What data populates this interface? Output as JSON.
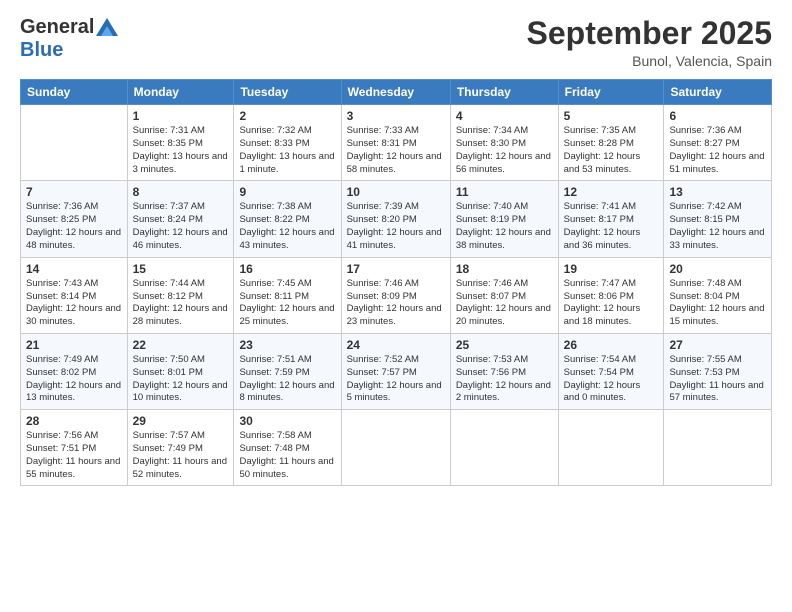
{
  "logo": {
    "general": "General",
    "blue": "Blue"
  },
  "title": "September 2025",
  "location": "Bunol, Valencia, Spain",
  "days_header": [
    "Sunday",
    "Monday",
    "Tuesday",
    "Wednesday",
    "Thursday",
    "Friday",
    "Saturday"
  ],
  "weeks": [
    [
      {
        "day": "",
        "info": ""
      },
      {
        "day": "1",
        "info": "Sunrise: 7:31 AM\nSunset: 8:35 PM\nDaylight: 13 hours\nand 3 minutes."
      },
      {
        "day": "2",
        "info": "Sunrise: 7:32 AM\nSunset: 8:33 PM\nDaylight: 13 hours\nand 1 minute."
      },
      {
        "day": "3",
        "info": "Sunrise: 7:33 AM\nSunset: 8:31 PM\nDaylight: 12 hours\nand 58 minutes."
      },
      {
        "day": "4",
        "info": "Sunrise: 7:34 AM\nSunset: 8:30 PM\nDaylight: 12 hours\nand 56 minutes."
      },
      {
        "day": "5",
        "info": "Sunrise: 7:35 AM\nSunset: 8:28 PM\nDaylight: 12 hours\nand 53 minutes."
      },
      {
        "day": "6",
        "info": "Sunrise: 7:36 AM\nSunset: 8:27 PM\nDaylight: 12 hours\nand 51 minutes."
      }
    ],
    [
      {
        "day": "7",
        "info": "Sunrise: 7:36 AM\nSunset: 8:25 PM\nDaylight: 12 hours\nand 48 minutes."
      },
      {
        "day": "8",
        "info": "Sunrise: 7:37 AM\nSunset: 8:24 PM\nDaylight: 12 hours\nand 46 minutes."
      },
      {
        "day": "9",
        "info": "Sunrise: 7:38 AM\nSunset: 8:22 PM\nDaylight: 12 hours\nand 43 minutes."
      },
      {
        "day": "10",
        "info": "Sunrise: 7:39 AM\nSunset: 8:20 PM\nDaylight: 12 hours\nand 41 minutes."
      },
      {
        "day": "11",
        "info": "Sunrise: 7:40 AM\nSunset: 8:19 PM\nDaylight: 12 hours\nand 38 minutes."
      },
      {
        "day": "12",
        "info": "Sunrise: 7:41 AM\nSunset: 8:17 PM\nDaylight: 12 hours\nand 36 minutes."
      },
      {
        "day": "13",
        "info": "Sunrise: 7:42 AM\nSunset: 8:15 PM\nDaylight: 12 hours\nand 33 minutes."
      }
    ],
    [
      {
        "day": "14",
        "info": "Sunrise: 7:43 AM\nSunset: 8:14 PM\nDaylight: 12 hours\nand 30 minutes."
      },
      {
        "day": "15",
        "info": "Sunrise: 7:44 AM\nSunset: 8:12 PM\nDaylight: 12 hours\nand 28 minutes."
      },
      {
        "day": "16",
        "info": "Sunrise: 7:45 AM\nSunset: 8:11 PM\nDaylight: 12 hours\nand 25 minutes."
      },
      {
        "day": "17",
        "info": "Sunrise: 7:46 AM\nSunset: 8:09 PM\nDaylight: 12 hours\nand 23 minutes."
      },
      {
        "day": "18",
        "info": "Sunrise: 7:46 AM\nSunset: 8:07 PM\nDaylight: 12 hours\nand 20 minutes."
      },
      {
        "day": "19",
        "info": "Sunrise: 7:47 AM\nSunset: 8:06 PM\nDaylight: 12 hours\nand 18 minutes."
      },
      {
        "day": "20",
        "info": "Sunrise: 7:48 AM\nSunset: 8:04 PM\nDaylight: 12 hours\nand 15 minutes."
      }
    ],
    [
      {
        "day": "21",
        "info": "Sunrise: 7:49 AM\nSunset: 8:02 PM\nDaylight: 12 hours\nand 13 minutes."
      },
      {
        "day": "22",
        "info": "Sunrise: 7:50 AM\nSunset: 8:01 PM\nDaylight: 12 hours\nand 10 minutes."
      },
      {
        "day": "23",
        "info": "Sunrise: 7:51 AM\nSunset: 7:59 PM\nDaylight: 12 hours\nand 8 minutes."
      },
      {
        "day": "24",
        "info": "Sunrise: 7:52 AM\nSunset: 7:57 PM\nDaylight: 12 hours\nand 5 minutes."
      },
      {
        "day": "25",
        "info": "Sunrise: 7:53 AM\nSunset: 7:56 PM\nDaylight: 12 hours\nand 2 minutes."
      },
      {
        "day": "26",
        "info": "Sunrise: 7:54 AM\nSunset: 7:54 PM\nDaylight: 12 hours\nand 0 minutes."
      },
      {
        "day": "27",
        "info": "Sunrise: 7:55 AM\nSunset: 7:53 PM\nDaylight: 11 hours\nand 57 minutes."
      }
    ],
    [
      {
        "day": "28",
        "info": "Sunrise: 7:56 AM\nSunset: 7:51 PM\nDaylight: 11 hours\nand 55 minutes."
      },
      {
        "day": "29",
        "info": "Sunrise: 7:57 AM\nSunset: 7:49 PM\nDaylight: 11 hours\nand 52 minutes."
      },
      {
        "day": "30",
        "info": "Sunrise: 7:58 AM\nSunset: 7:48 PM\nDaylight: 11 hours\nand 50 minutes."
      },
      {
        "day": "",
        "info": ""
      },
      {
        "day": "",
        "info": ""
      },
      {
        "day": "",
        "info": ""
      },
      {
        "day": "",
        "info": ""
      }
    ]
  ]
}
